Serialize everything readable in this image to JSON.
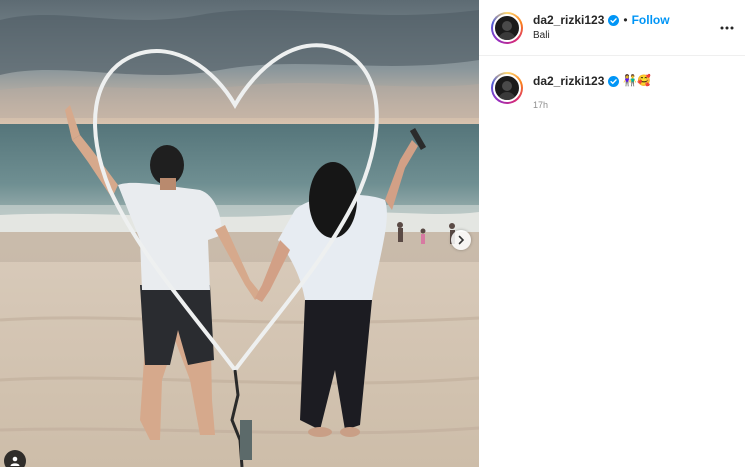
{
  "post": {
    "username": "da2_rizki123",
    "follow_label": "Follow",
    "separator": "•",
    "location": "Bali",
    "caption_emojis": "👫🥰",
    "timestamp": "17h"
  },
  "icons": {
    "verified": "verified-badge-icon",
    "more": "more-options-icon",
    "next": "chevron-right-icon",
    "user_tag": "user-tag-icon"
  },
  "colors": {
    "accent": "#0095f6",
    "text": "#262626",
    "muted": "#8e8e8e"
  }
}
